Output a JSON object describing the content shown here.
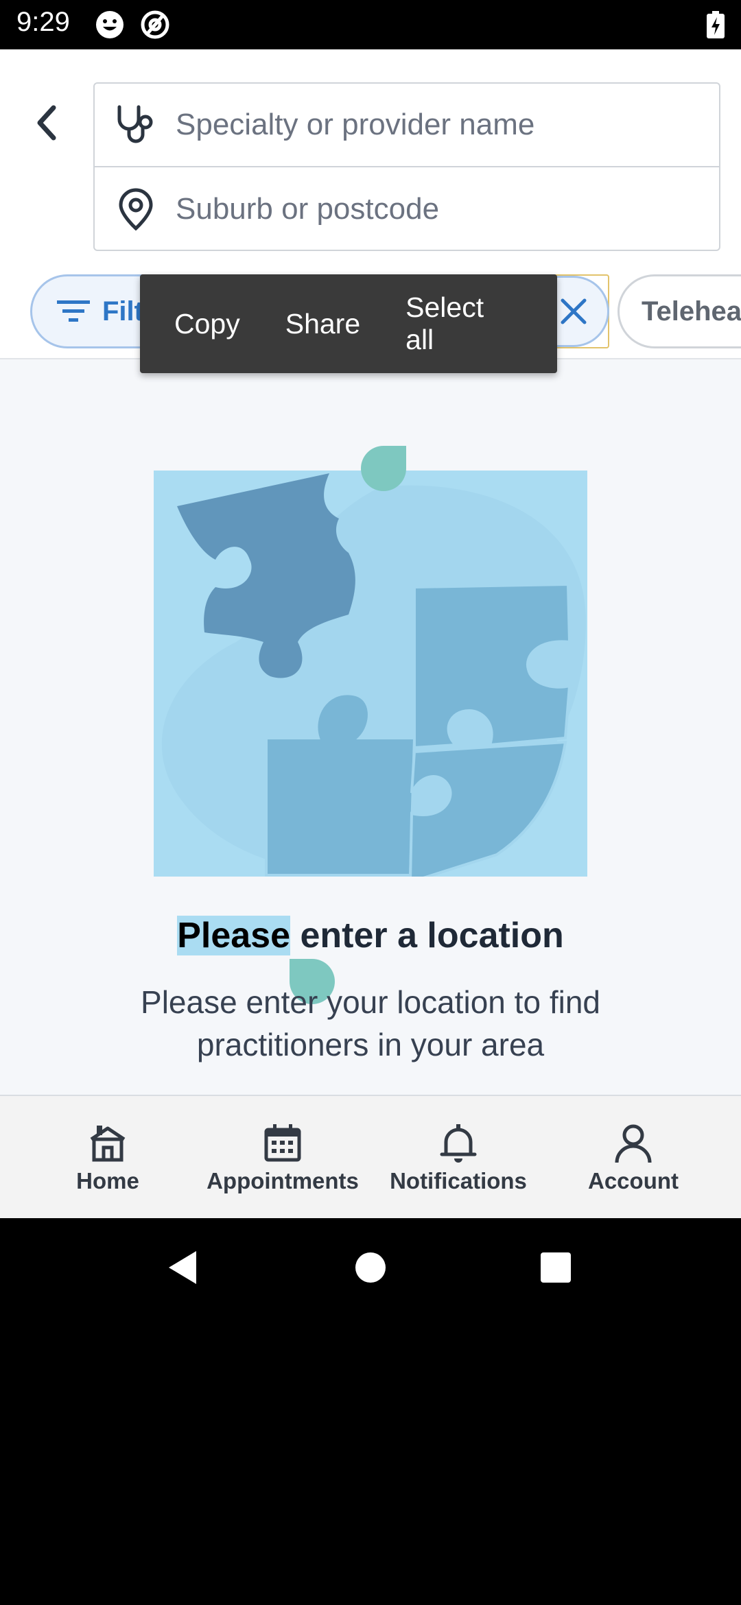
{
  "status_bar": {
    "time": "9:29"
  },
  "search": {
    "specialty_placeholder": "Specialty or provider name",
    "location_placeholder": "Suburb or postcode"
  },
  "chips": {
    "filter_label": "Filt",
    "telehealth_label": "Teleheal"
  },
  "context_menu": {
    "items": [
      "Copy",
      "Share",
      "Select all"
    ]
  },
  "empty_state": {
    "title_selected": "Please",
    "title_rest": " enter a location",
    "body": "Please enter your location to find practitioners in your area"
  },
  "bottom_nav": {
    "items": [
      {
        "label": "Home",
        "icon": "home-icon"
      },
      {
        "label": "Appointments",
        "icon": "calendar-icon"
      },
      {
        "label": "Notifications",
        "icon": "bell-icon"
      },
      {
        "label": "Account",
        "icon": "person-icon"
      }
    ]
  },
  "colors": {
    "accent": "#2e76c6",
    "illustration_bg": "#aadcf2",
    "selection_handle": "#7ec8c0"
  }
}
